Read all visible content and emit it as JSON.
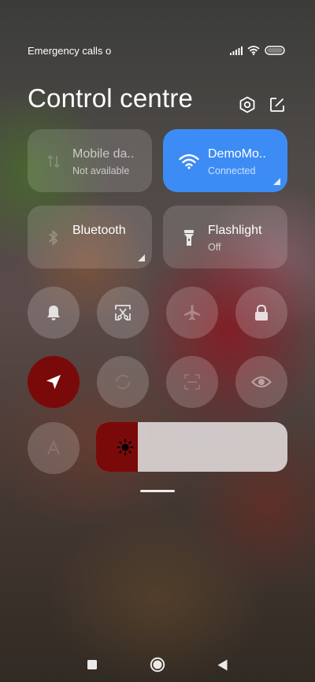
{
  "status_bar": {
    "left_text": "Emergency calls o",
    "icons": [
      "signal-icon",
      "wifi-icon",
      "battery-icon"
    ]
  },
  "header": {
    "title": "Control centre",
    "icons": [
      "settings-hexagon-icon",
      "edit-icon"
    ]
  },
  "tiles": [
    {
      "title": "Mobile da..",
      "subtitle": "Not available",
      "icon": "mobile-data-icon",
      "active": false
    },
    {
      "title": "DemoMo..",
      "subtitle": "Connected",
      "icon": "wifi-icon",
      "active": true,
      "color": "#3d8cf5"
    },
    {
      "title": "Bluetooth",
      "subtitle": "",
      "icon": "bluetooth-icon",
      "active": false
    },
    {
      "title": "Flashlight",
      "subtitle": "Off",
      "icon": "flashlight-icon",
      "active": false
    }
  ],
  "toggles": [
    {
      "icon": "bell-icon",
      "active": false
    },
    {
      "icon": "screenshot-scissors-icon",
      "active": false
    },
    {
      "icon": "airplane-icon",
      "active": false
    },
    {
      "icon": "lock-icon",
      "active": false
    },
    {
      "icon": "location-arrow-icon",
      "active": true,
      "color": "#7a0a0a"
    },
    {
      "icon": "rotation-lock-icon",
      "active": false
    },
    {
      "icon": "scanner-icon",
      "active": false
    },
    {
      "icon": "eye-icon",
      "active": false
    },
    {
      "icon": "auto-brightness-icon",
      "active": false
    }
  ],
  "brightness": {
    "level": 0.22,
    "icon": "sun-icon",
    "fill_color": "#7a0a0a"
  },
  "nav_bar": {
    "icons": [
      "recents-square-icon",
      "home-circle-icon",
      "back-triangle-icon"
    ]
  }
}
